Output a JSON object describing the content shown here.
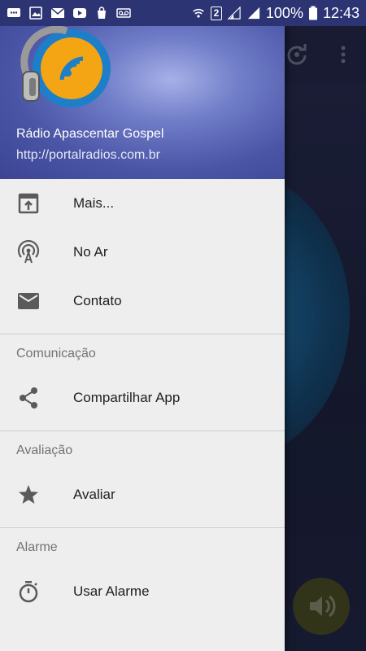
{
  "status_bar": {
    "battery_text": "100%",
    "time": "12:43",
    "sim_slot": "2"
  },
  "drawer": {
    "header": {
      "title": "Rádio Apascentar Gospel",
      "url": "http://portalradios.com.br"
    },
    "items": [
      {
        "label": "Mais...",
        "icon": "open-in-app-icon"
      },
      {
        "label": "No Ar",
        "icon": "broadcast-icon"
      },
      {
        "label": "Contato",
        "icon": "mail-icon"
      }
    ],
    "sections": [
      {
        "title": "Comunicação",
        "items": [
          {
            "label": "Compartilhar App",
            "icon": "share-icon"
          }
        ]
      },
      {
        "title": "Avaliação",
        "items": [
          {
            "label": "Avaliar",
            "icon": "star-icon"
          }
        ]
      },
      {
        "title": "Alarme",
        "items": [
          {
            "label": "Usar Alarme",
            "icon": "timer-icon"
          }
        ]
      }
    ]
  },
  "colors": {
    "drawer_bg": "#eeeeee",
    "header_gradient_center": "#a7b0e8",
    "header_gradient_edge": "#3c4594",
    "icon_color": "#5a5a5a",
    "section_title_color": "#737373"
  }
}
